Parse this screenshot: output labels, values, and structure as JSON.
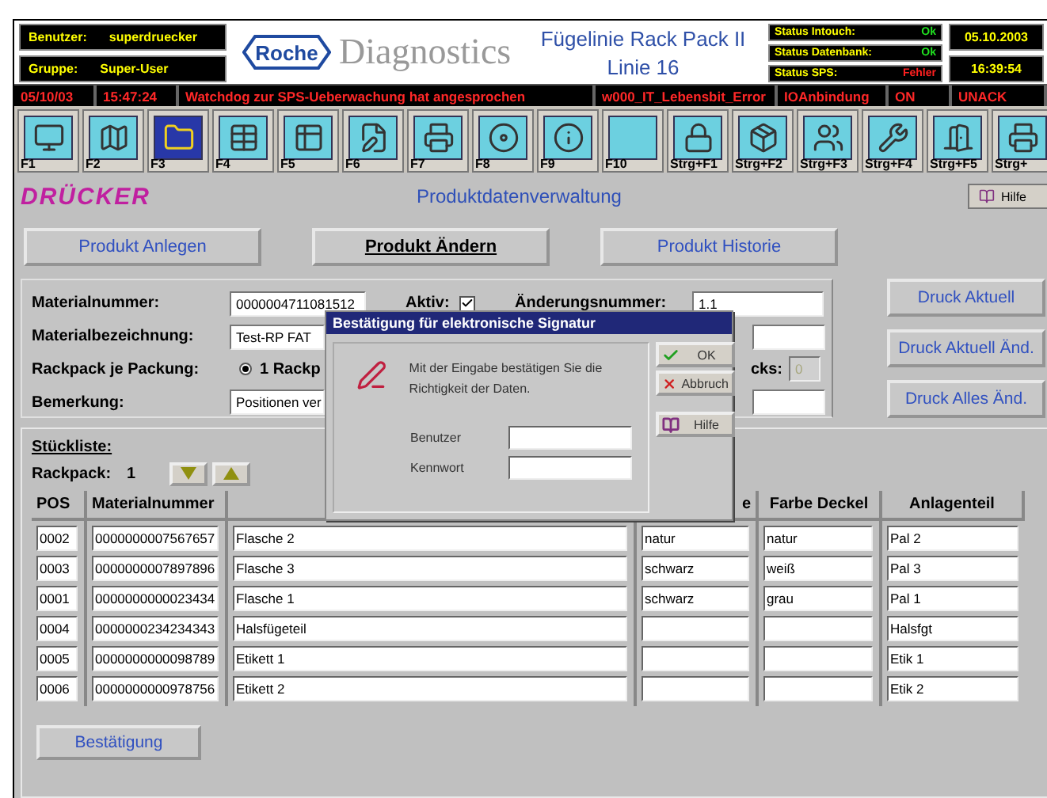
{
  "header": {
    "user": {
      "label": "Benutzer:",
      "value": "superdruecker"
    },
    "group": {
      "label": "Gruppe:",
      "value": "Super-User"
    },
    "logo": {
      "badge": "Roche",
      "name": "Diagnostics"
    },
    "title": [
      "Fügelinie Rack Pack II",
      "Linie 16"
    ],
    "status": [
      {
        "label": "Status Intouch:",
        "value": "Ok",
        "error": false
      },
      {
        "label": "Status Datenbank:",
        "value": "Ok",
        "error": false
      },
      {
        "label": "Status SPS:",
        "value": "Fehler",
        "error": true
      }
    ],
    "date": "05.10.2003",
    "time": "16:39:54"
  },
  "alarm_bar": [
    "05/10/03",
    "15:47:24",
    "Watchdog zur SPS-Ueberwachung hat angesprochen",
    "w000_IT_Lebensbit_Error",
    "IOAnbindung",
    "ON",
    "UNACK"
  ],
  "toolbar": [
    {
      "label": "F1",
      "selected": false
    },
    {
      "label": "F2",
      "selected": false
    },
    {
      "label": "F3",
      "selected": true
    },
    {
      "label": "F4",
      "selected": false
    },
    {
      "label": "F5",
      "selected": false
    },
    {
      "label": "F6",
      "selected": false
    },
    {
      "label": "F7",
      "selected": false
    },
    {
      "label": "F8",
      "selected": false
    },
    {
      "label": "F9",
      "selected": false
    },
    {
      "label": "F10",
      "selected": false
    },
    {
      "label": "Strg+F1",
      "selected": false
    },
    {
      "label": "Strg+F2",
      "selected": false
    },
    {
      "label": "Strg+F3",
      "selected": false
    },
    {
      "label": "Strg+F4",
      "selected": false
    },
    {
      "label": "Strg+F5",
      "selected": false
    },
    {
      "label": "Strg+",
      "selected": false
    }
  ],
  "page": {
    "logo": "DRÜCKER",
    "title": "Produktdatenverwaltung",
    "help": "Hilfe"
  },
  "tabs": [
    {
      "label": "Produkt Anlegen",
      "selected": false
    },
    {
      "label": "Produkt Ändern",
      "selected": true
    },
    {
      "label": "Produkt Historie",
      "selected": false
    }
  ],
  "form": {
    "materialnummer": {
      "label": "Materialnummer:",
      "value": "0000004711081512"
    },
    "aktiv": {
      "label": "Aktiv:",
      "checked": true
    },
    "aenderungsnummer": {
      "label": "Änderungsnummer:",
      "value": "1.1"
    },
    "materialbezeichnung": {
      "label": "Materialbezeichnung:",
      "value": "Test-RP FAT"
    },
    "rackpack": {
      "label": "Rackpack je Packung:",
      "option": "1 Rackp",
      "selected": true
    },
    "field_cks": {
      "label": "cks:",
      "value": "0",
      "disabled": true
    },
    "bemerkung": {
      "label": "Bemerkung:",
      "value": "Positionen ver"
    }
  },
  "print_buttons": [
    "Druck Aktuell",
    "Druck Aktuell Änd.",
    "Druck Alles Änd."
  ],
  "parts_list": {
    "title": "Stückliste:",
    "rackpack_label": "Rackpack:",
    "rackpack_value": "1",
    "columns": [
      "POS",
      "Materialnummer",
      "",
      "e",
      "Farbe Deckel",
      "Anlagenteil"
    ],
    "rows": [
      [
        "0002",
        "0000000007567657",
        "Flasche 2",
        "natur",
        "natur",
        "Pal 2"
      ],
      [
        "0003",
        "0000000007897896",
        "Flasche 3",
        "schwarz",
        "weiß",
        "Pal 3"
      ],
      [
        "0001",
        "0000000000023434",
        "Flasche 1",
        "schwarz",
        "grau",
        "Pal 1"
      ],
      [
        "0004",
        "0000000234234343",
        "Halsfügeteil",
        "",
        "",
        "Halsfgt"
      ],
      [
        "0005",
        "0000000000098789",
        "Etikett 1",
        "",
        "",
        "Etik 1"
      ],
      [
        "0006",
        "0000000000978756",
        "Etikett 2",
        "",
        "",
        "Etik 2"
      ]
    ],
    "confirm": "Bestätigung"
  },
  "dialog": {
    "title": "Bestätigung für elektronische Signatur",
    "message": "Mit der Eingabe bestätigen Sie die Richtigkeit der Daten.",
    "fields": [
      "Benutzer",
      "Kennwort"
    ],
    "buttons": [
      {
        "kind": "ok",
        "label": "OK"
      },
      {
        "kind": "cancel",
        "label": "Abbruch"
      },
      {
        "kind": "help",
        "label": "Hilfe"
      }
    ]
  }
}
